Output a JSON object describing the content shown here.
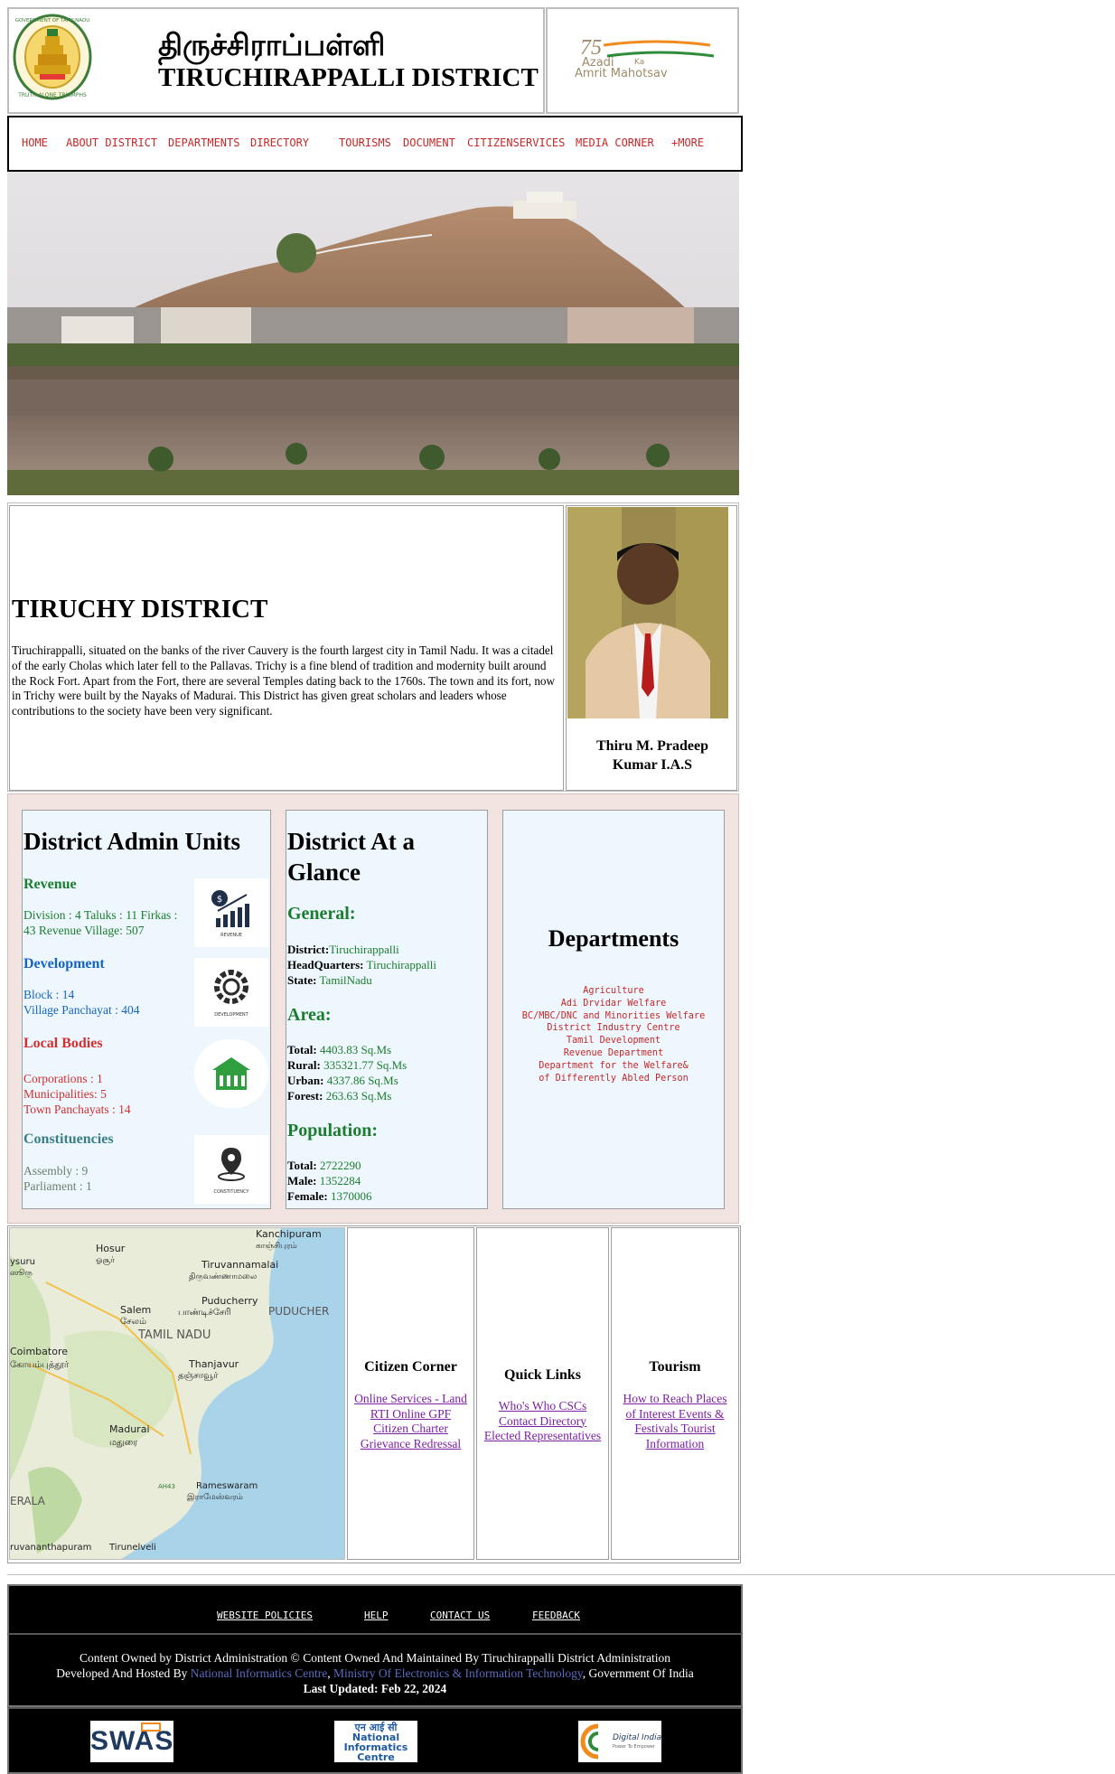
{
  "header": {
    "title_tamil": "திருச்சிராப்பள்ளி",
    "title_english": "TIRUCHIRAPPALLI DISTRICT",
    "emblem_text": "GOVERNMENT OF TAMILNADU",
    "emblem_motto": "TRUTH ALONE TRIUMPHS",
    "azadi_number": "75",
    "azadi_line1": "Azadi",
    "azadi_ka": "Ka",
    "azadi_line2": "Amrit Mahotsav"
  },
  "nav": {
    "items": [
      "HOME",
      "ABOUT DISTRICT",
      "DEPARTMENTS",
      "DIRECTORY",
      "TOURISMS",
      "DOCUMENT",
      "CITIZENSERVICES",
      "MEDIA CORNER",
      "+MORE"
    ]
  },
  "about": {
    "title": "TIRUCHY DISTRICT",
    "text": "Tiruchirappalli, situated on the banks of the river Cauvery is the fourth largest city in Tamil Nadu. It was a citadel of the early Cholas which later fell to the Pallavas. Trichy is a fine blend of tradition and modernity built around the Rock Fort. Apart from the Fort, there are several Temples dating back to the 1760s. The town and its fort, now in Trichy were built by the Nayaks of Madurai. This District has given great scholars and leaders whose contributions to the society have been very significant.",
    "officer_line1": "Thiru M. Pradeep",
    "officer_line2": "Kumar I.A.S"
  },
  "admin_units": {
    "title": "District Admin Units",
    "revenue_heading": "Revenue",
    "revenue_line1": "Division : 4 Taluks : 11 Firkas :",
    "revenue_line2": "43 Revenue Village: 507",
    "revenue_icon_caption": "REVENUE",
    "development_heading": "Development",
    "development_line1": "Block : 14",
    "development_line2": "Village Panchayat : 404",
    "development_icon_caption": "DEVELOPMENT",
    "local_heading": "Local Bodies",
    "local_line1": "Corporations : 1",
    "local_line2": "Municipalities: 5",
    "local_line3": "Town Panchayats : 14",
    "const_heading": "Constituencies",
    "const_line1": "Assembly : 9",
    "const_line2": "Parliament : 1",
    "const_icon_caption": "CONSTITUENCY"
  },
  "glance": {
    "title_line1": "District At a",
    "title_line2": "Glance",
    "general_heading": "General:",
    "district_label": "District:",
    "district_value": "Tiruchirappalli",
    "hq_label": "HeadQuarters:",
    "hq_value": " Tiruchirappalli",
    "state_label": "State:",
    "state_value": " TamilNadu",
    "area_heading": "Area:",
    "total_area_label": "Total:",
    "total_area_value": " 4403.83 Sq.Ms",
    "rural_label": "Rural:",
    "rural_value": " 335321.77 Sq.Ms",
    "urban_label": "Urban:",
    "urban_value": " 4337.86 Sq.Ms",
    "forest_label": "Forest:",
    "forest_value": " 263.63 Sq.Ms",
    "population_heading": "Population:",
    "pop_total_label": "Total:",
    "pop_total_value": " 2722290",
    "male_label": "Male:",
    "male_value": " 1352284",
    "female_label": "Female:",
    "female_value": " 1370006"
  },
  "departments": {
    "title": "Departments",
    "items": [
      "Agriculture",
      "Adi Drvidar Welfare",
      "BC/MBC/DNC and Minorities Welfare",
      "District Industry Centre",
      "Tamil Development",
      "Revenue Department",
      "Department for the Welfare&",
      "of Differently Abled Person"
    ]
  },
  "map": {
    "labels": [
      "Kanchipuram",
      "காஞ்சிபுரம்",
      "Hosur",
      "ஓசூர்",
      "Tiruvannamalai",
      "திருவண்ணாமலை",
      "Puducherry",
      "பாண்டிச்சேரி",
      "PUDUCHER",
      "Salem",
      "சேலம்",
      "TAMIL NADU",
      "Coimbatore",
      "கோயம்புத்தூர்",
      "Thanjavur",
      "தஞ்சாவூர்",
      "Madurai",
      "மதுரை",
      "AH43",
      "Rameswaram",
      "இராமேஸ்வரம்",
      "ERALA",
      "Tirunelveli",
      "ruvananthapuram",
      "ysuru",
      "ஸூரு"
    ]
  },
  "citizen_corner": {
    "title": "Citizen Corner",
    "links": [
      "Online Services - Land",
      "RTI Online GPF",
      "Citizen Charter",
      "Grievance Redressal"
    ]
  },
  "quick_links": {
    "title": "Quick Links",
    "links": [
      "Who's Who CSCs",
      "Contact Directory",
      "Elected Representatives"
    ]
  },
  "tourism": {
    "title": "Tourism",
    "links": [
      "How to Reach Places",
      "of Interest Events &",
      "Festivals Tourist",
      "Information"
    ]
  },
  "footer": {
    "links": [
      "WEBSITE POLICIES",
      "HELP",
      "CONTACT US",
      "FEEDBACK"
    ],
    "line1": "Content Owned by District Administration © Content Owned And Maintained By Tiruchirappalli District Administration",
    "line2_prefix": "Developed And Hosted By ",
    "line2_link1": "National Informatics Centre",
    "line2_sep": ", ",
    "line2_link2": "Ministry Of Electronics & Information Technology",
    "line2_suffix": ", Government Of India",
    "line3": "Last Updated: Feb 22, 2024",
    "logo_swaas": "SWAS",
    "logo_nic_hindi": "एन आई सी",
    "logo_nic_1": "National",
    "logo_nic_2": "Informatics",
    "logo_nic_3": "Centre",
    "logo_di": "Digital India",
    "logo_di_sub": "Power To Empower"
  },
  "colors": {
    "nav_text": "#c62828",
    "cards_bg": "#f1e3df",
    "card_bg": "#eef7fd",
    "footer_bg": "#000000"
  }
}
